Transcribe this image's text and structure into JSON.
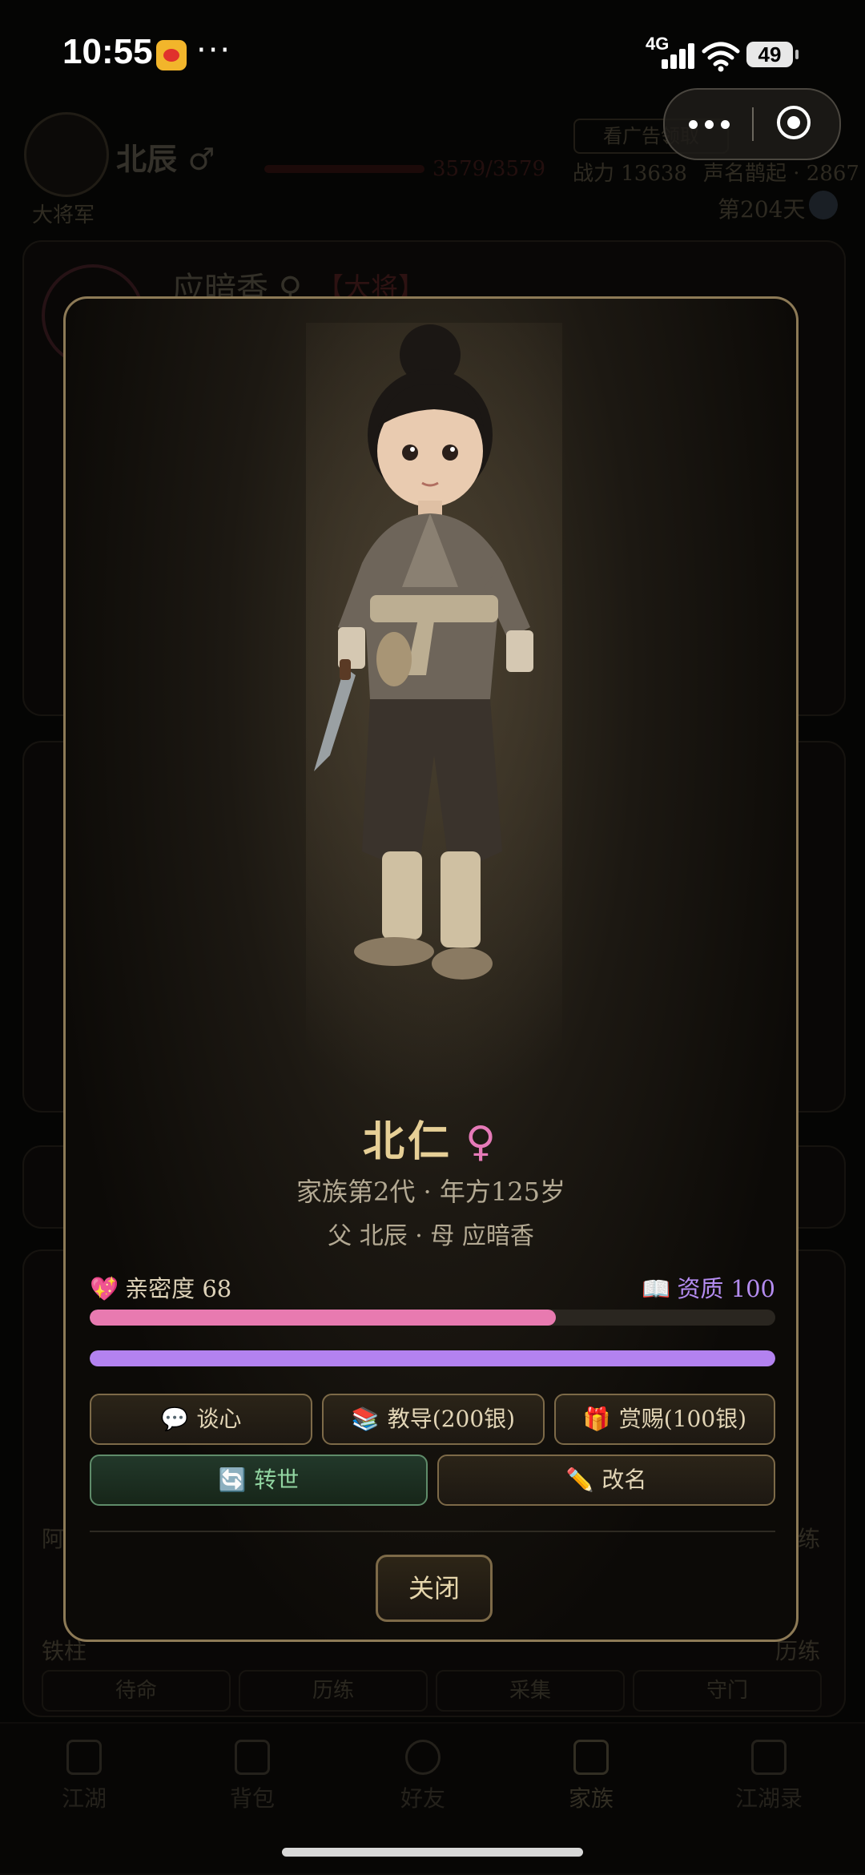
{
  "status_bar": {
    "time": "10:55",
    "network": "4G",
    "battery": "49",
    "more": "···"
  },
  "background_page": {
    "player_name": "北辰 ♂",
    "rank": "大将军",
    "hp": "3579/3579",
    "power": "战力 13638",
    "fame": "声名鹊起 · 2867",
    "day": "第204天",
    "ad_button": "看广告领取",
    "spouse_name": "应暗香 ♀",
    "spouse_tag": "【大将】",
    "row_label_1": "阿",
    "row_right_1": "历练",
    "row_label_2": "铁柱",
    "row_right_2": "历练",
    "chips": [
      "待命",
      "历练",
      "采集",
      "守门"
    ],
    "tabs": [
      {
        "label": "江湖",
        "icon": "chart-icon"
      },
      {
        "label": "背包",
        "icon": "bag-icon"
      },
      {
        "label": "好友",
        "icon": "friends-icon"
      },
      {
        "label": "家族",
        "icon": "home-icon",
        "active": true
      },
      {
        "label": "江湖录",
        "icon": "book-icon"
      }
    ]
  },
  "modal": {
    "name": "北仁",
    "gender_symbol": "♀",
    "generation": "家族第2代 · 年方125岁",
    "parents": "父 北辰 · 母 应暗香",
    "intimacy_label": "亲密度 68",
    "intimacy_icon": "💖",
    "intimacy_fraction": 0.68,
    "aptitude_label": "资质 100",
    "aptitude_icon": "📖",
    "aptitude_fraction": 1.0,
    "buttons": {
      "talk": {
        "icon": "💬",
        "label": "谈心"
      },
      "teach": {
        "icon": "📚",
        "label": "教导(200银)"
      },
      "reward": {
        "icon": "🎁",
        "label": "赏赐(100银)"
      },
      "rebirth": {
        "icon": "🔄",
        "label": "转世"
      },
      "rename": {
        "icon": "✏️",
        "label": "改名"
      }
    },
    "close_label": "关闭"
  },
  "colors": {
    "gold": "#e6cf96",
    "intimacy_pink": "#e87ab0",
    "aptitude_purple": "#b382f0",
    "rebirth_green": "#92d6a2",
    "border": "#8d7a56"
  }
}
